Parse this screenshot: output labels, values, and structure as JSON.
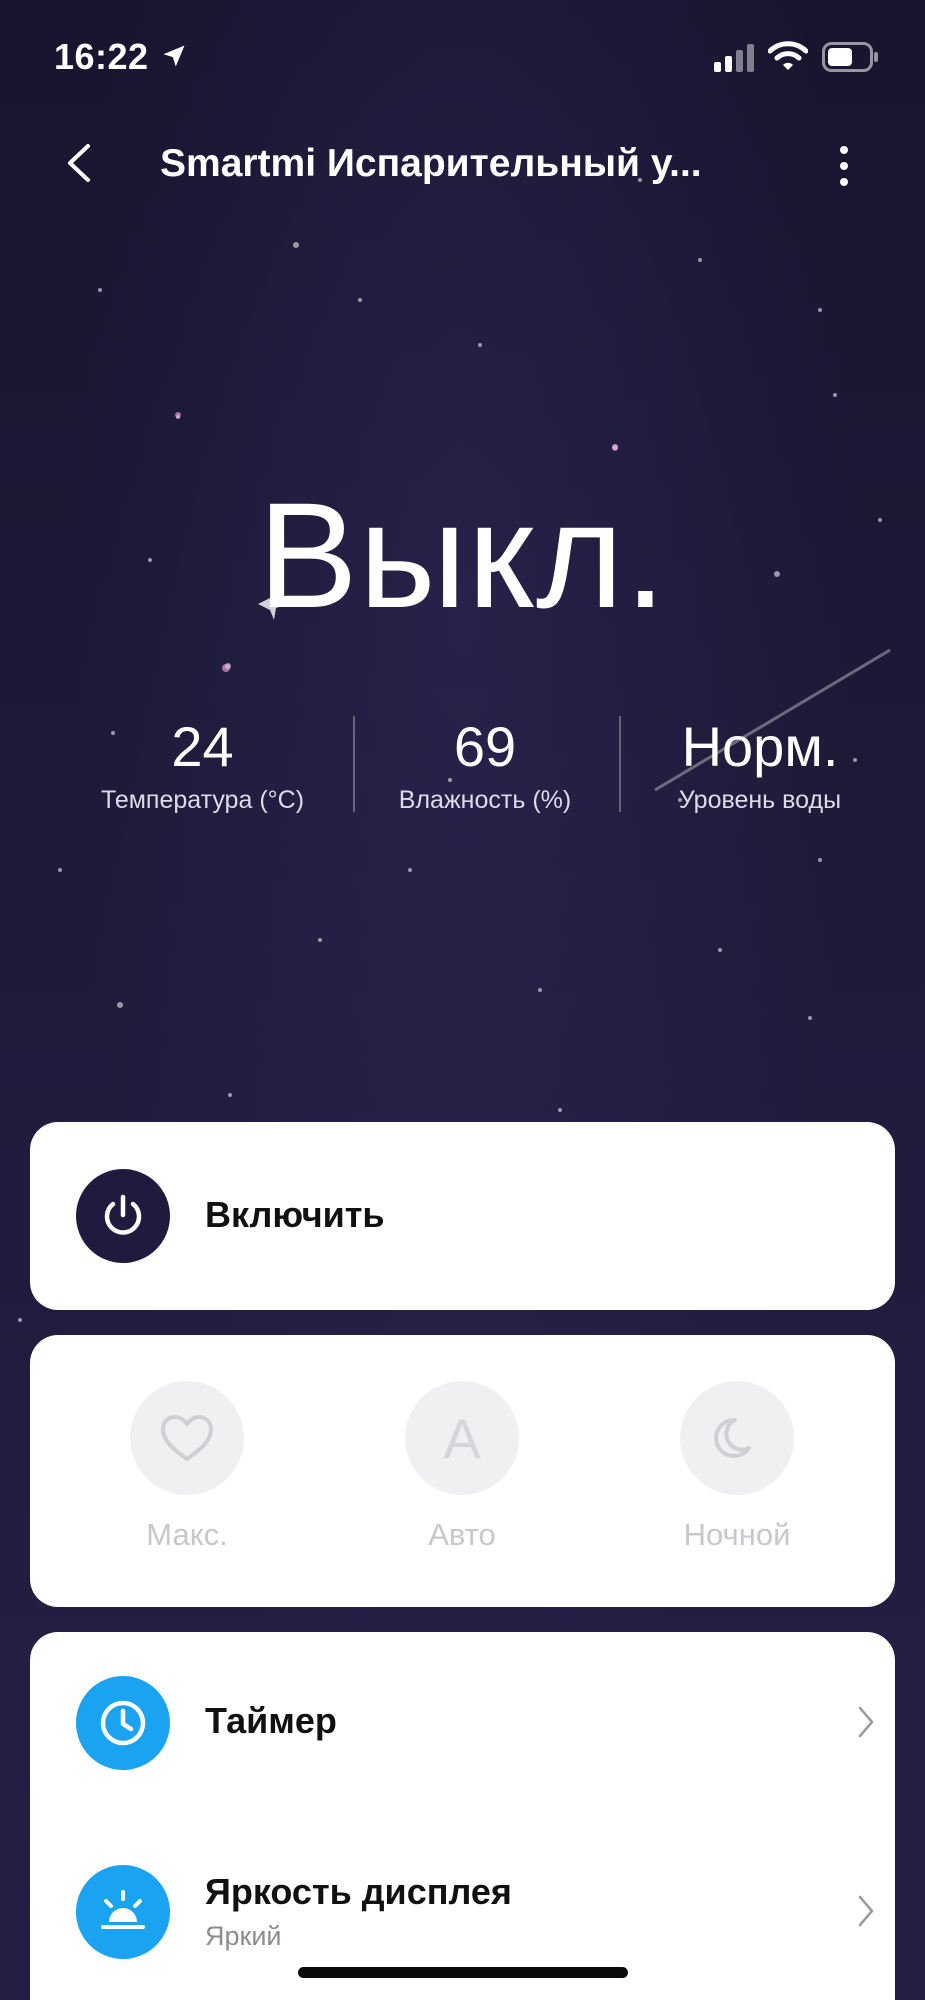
{
  "status": {
    "time": "16:22",
    "icons": [
      "location-arrow-icon",
      "cellular-signal-icon",
      "wifi-icon",
      "battery-icon"
    ]
  },
  "nav": {
    "title": "Smartmi Испарительный у...",
    "back_icon": "chevron-left-icon",
    "more_icon": "more-vertical-icon"
  },
  "hero": {
    "state": "Выкл.",
    "stats": [
      {
        "value": "24",
        "label": "Температура (°C)"
      },
      {
        "value": "69",
        "label": "Влажность (%)"
      },
      {
        "value": "Норм.",
        "label": "Уровень воды"
      }
    ]
  },
  "power": {
    "label": "Включить",
    "icon": "power-icon"
  },
  "modes": [
    {
      "label": "Макс.",
      "icon": "heart-icon"
    },
    {
      "label": "Авто",
      "icon": "letter-a-icon",
      "glyph": "A"
    },
    {
      "label": "Ночной",
      "icon": "moon-icon"
    }
  ],
  "settings": [
    {
      "title": "Таймер",
      "icon": "clock-icon"
    },
    {
      "title": "Яркость дисплея",
      "subtitle": "Яркий",
      "icon": "sunrise-icon"
    }
  ],
  "colors": {
    "background": "#1d1a38",
    "accent_blue": "#1aa3f0",
    "power_button": "#1e1b3e",
    "mode_disabled_text": "#c8c8cc"
  }
}
